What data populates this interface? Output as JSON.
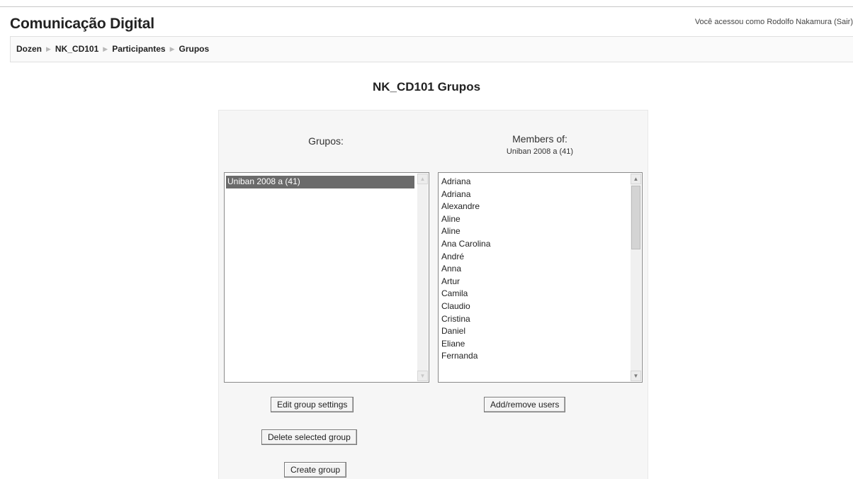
{
  "header": {
    "site_title": "Comunicação Digital",
    "login_info": "Você acessou como Rodolfo Nakamura (Sair)"
  },
  "breadcrumb": {
    "items": [
      "Dozen",
      "NK_CD101",
      "Participantes",
      "Grupos"
    ],
    "separator": "▶"
  },
  "page": {
    "heading": "NK_CD101 Grupos"
  },
  "groups_panel": {
    "title": "Grupos:",
    "items": [
      "Uniban 2008 a (41)"
    ],
    "selected_index": 0
  },
  "members_panel": {
    "title": "Members of:",
    "subtitle": "Uniban 2008 a (41)",
    "items": [
      "Adriana",
      "Adriana",
      "Alexandre",
      "Aline",
      "Aline",
      "Ana Carolina",
      "André",
      "Anna",
      "Artur",
      "Camila",
      "Claudio",
      "Cristina",
      "Daniel",
      "Eliane",
      "Fernanda"
    ]
  },
  "buttons": {
    "edit_group_settings": "Edit group settings",
    "delete_selected_group": "Delete selected group",
    "create_group": "Create group",
    "add_remove_users": "Add/remove users"
  },
  "colors": {
    "selected_item_bg": "#6b6b6b",
    "panel_bg": "#f6f6f6",
    "navbar_bg": "#fafafa"
  }
}
